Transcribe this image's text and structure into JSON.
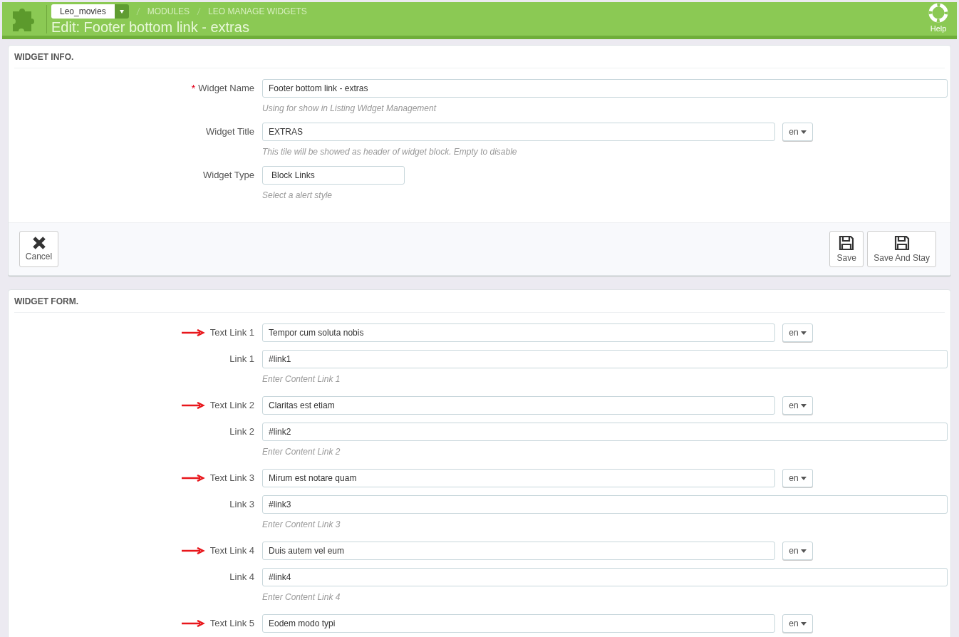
{
  "header": {
    "shop_select": "Leo_movies",
    "breadcrumb": [
      "MODULES",
      "LEO MANAGE WIDGETS"
    ],
    "title": "Edit: Footer bottom link - extras",
    "help": "Help"
  },
  "widget_info": {
    "title": "WIDGET INFO.",
    "required_mark": "*",
    "fields": [
      {
        "kind": "text",
        "label": "Widget Name",
        "required": true,
        "value": "Footer bottom link - extras",
        "hint": "Using for show in Listing Widget Management"
      },
      {
        "kind": "lang",
        "label": "Widget Title",
        "required": false,
        "value": "EXTRAS",
        "lang": "en",
        "hint": "This tile will be showed as header of widget block. Empty to disable"
      },
      {
        "kind": "select",
        "label": "Widget Type",
        "required": false,
        "value": "Block Links",
        "hint": "Select a alert style"
      }
    ],
    "cancel": "Cancel",
    "save": "Save",
    "save_stay": "Save And Stay"
  },
  "widget_form": {
    "title": "WIDGET FORM.",
    "fields": [
      {
        "kind": "lang",
        "label": "Text Link 1",
        "arrow": true,
        "value": "Tempor cum soluta nobis",
        "lang": "en"
      },
      {
        "kind": "text",
        "label": "Link 1",
        "arrow": false,
        "value": "#link1",
        "hint": "Enter Content Link 1"
      },
      {
        "kind": "lang",
        "label": "Text Link 2",
        "arrow": true,
        "value": "Claritas est etiam",
        "lang": "en"
      },
      {
        "kind": "text",
        "label": "Link 2",
        "arrow": false,
        "value": "#link2",
        "hint": "Enter Content Link 2"
      },
      {
        "kind": "lang",
        "label": "Text Link 3",
        "arrow": true,
        "value": "Mirum est notare quam",
        "lang": "en"
      },
      {
        "kind": "text",
        "label": "Link 3",
        "arrow": false,
        "value": "#link3",
        "hint": "Enter Content Link 3"
      },
      {
        "kind": "lang",
        "label": "Text Link 4",
        "arrow": true,
        "value": "Duis autem vel eum",
        "lang": "en"
      },
      {
        "kind": "text",
        "label": "Link 4",
        "arrow": false,
        "value": "#link4",
        "hint": "Enter Content Link 4"
      },
      {
        "kind": "lang",
        "label": "Text Link 5",
        "arrow": true,
        "value": "Eodem modo typi",
        "lang": "en"
      }
    ]
  }
}
